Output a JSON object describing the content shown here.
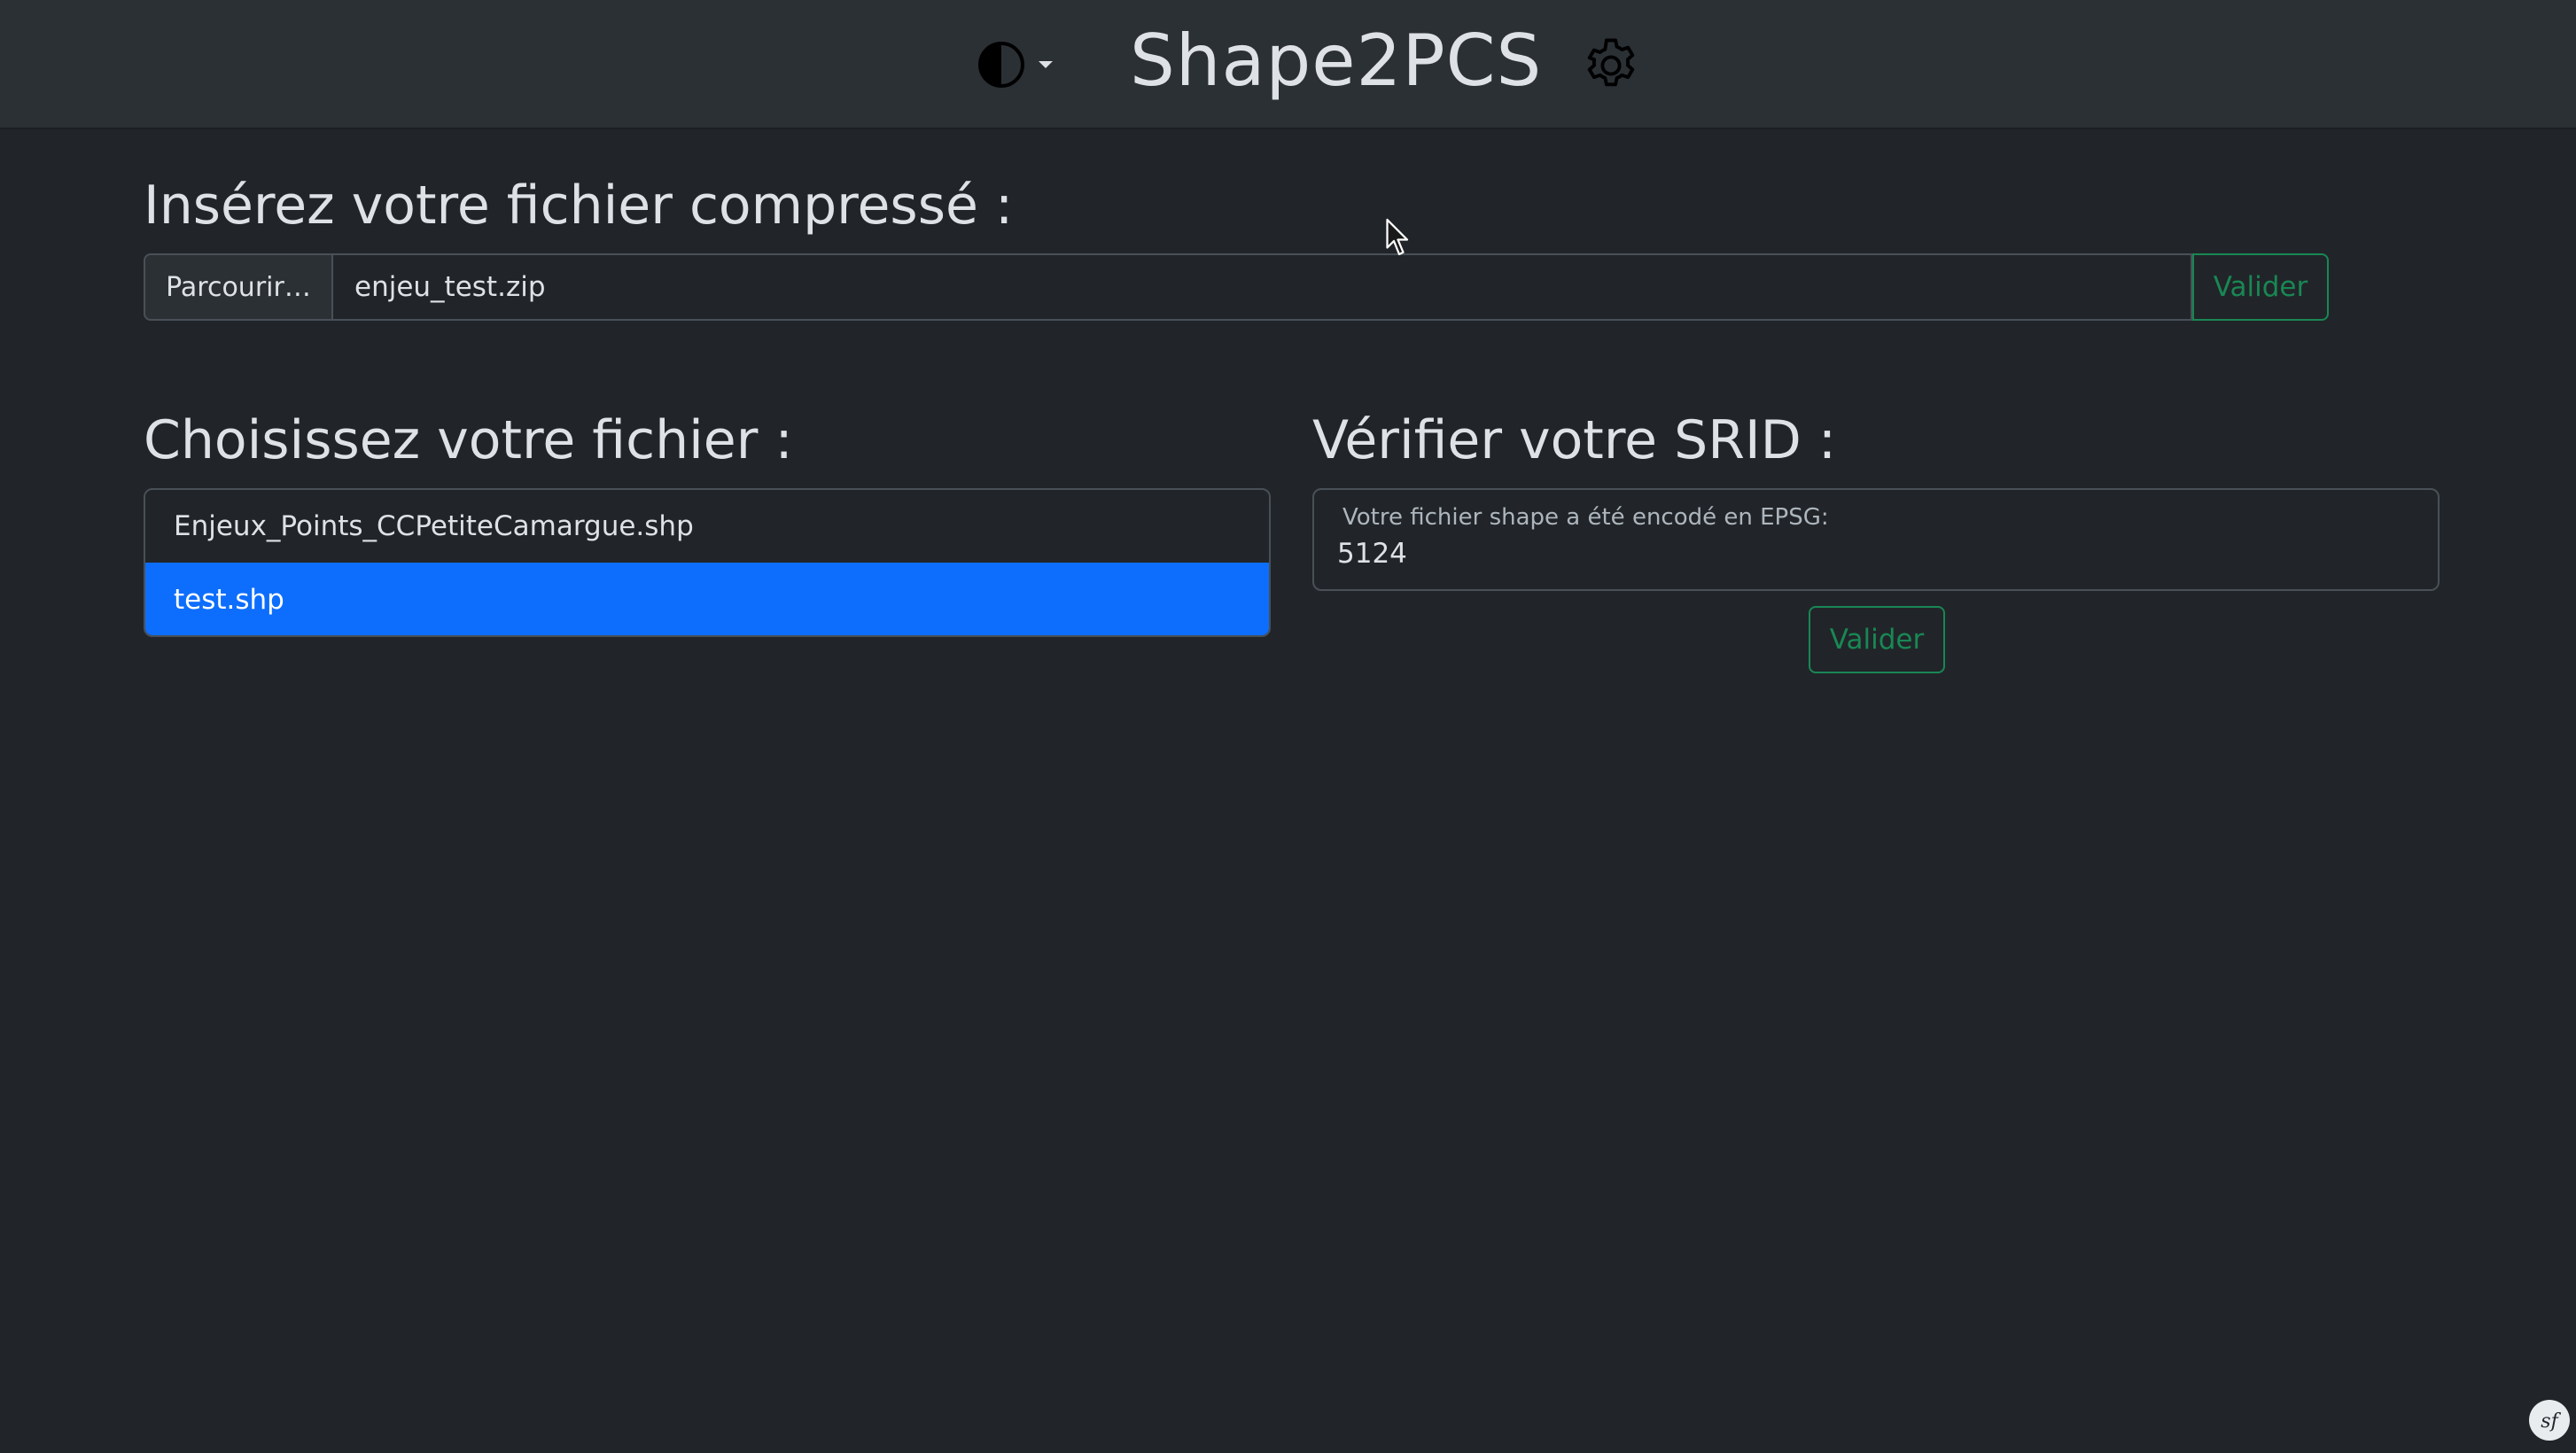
{
  "header": {
    "title": "Shape2PCS",
    "theme_icon": "contrast-half-circle-icon",
    "theme_caret_icon": "caret-down-icon",
    "settings_icon": "gear-icon"
  },
  "upload": {
    "heading": "Insérez votre fichier compressé :",
    "browse_label": "Parcourir…",
    "file_name": "enjeu_test.zip",
    "submit_label": "Valider"
  },
  "files": {
    "heading": "Choisissez votre fichier :",
    "items": [
      {
        "label": "Enjeux_Points_CCPetiteCamargue.shp",
        "selected": false
      },
      {
        "label": "test.shp",
        "selected": true
      }
    ]
  },
  "srid": {
    "heading": "Vérifier votre SRID :",
    "field_label": "Votre fichier shape a été encodé en EPSG:",
    "field_value": "5124",
    "submit_label": "Valider"
  },
  "colors": {
    "background": "#212529",
    "navbar": "#2b3035",
    "primary": "#0d6efd",
    "success": "#198754"
  },
  "toolbar_badge_icon": "symfony-logo-icon"
}
